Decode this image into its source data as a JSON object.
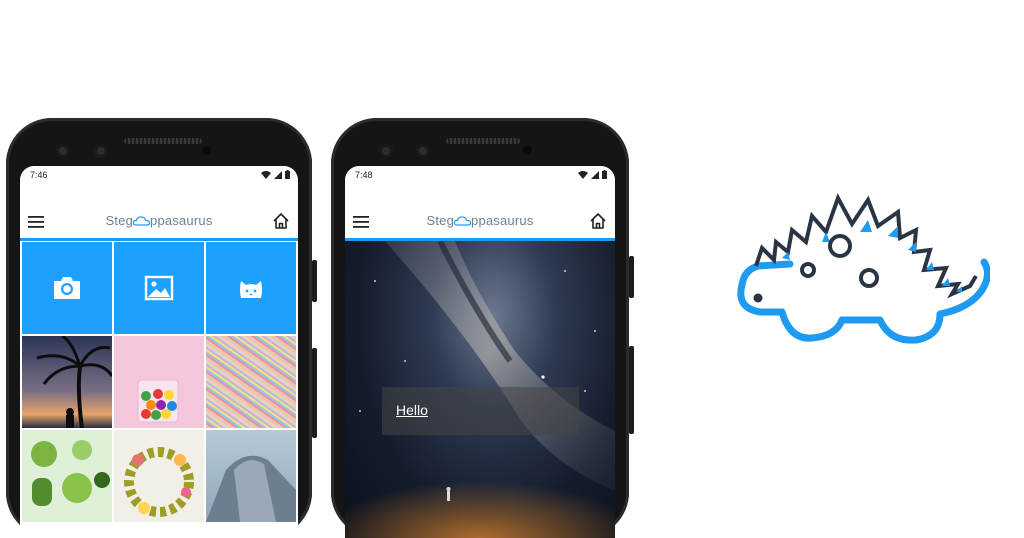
{
  "colors": {
    "accent": "#1e9bf0",
    "tile_blue": "#1ea0ff",
    "dino_dark": "#2a3544"
  },
  "phone1": {
    "status_time": "7:46",
    "brand": {
      "prefix": "Steg",
      "suffix": "ppasaurus"
    },
    "tiles": [
      {
        "icon": "camera-icon"
      },
      {
        "icon": "image-icon"
      },
      {
        "icon": "cat-icon"
      }
    ],
    "thumbnails": [
      {
        "subject": "palm-tree-sunset"
      },
      {
        "subject": "candy-jar"
      },
      {
        "subject": "sprinkles"
      },
      {
        "subject": "vegetables"
      },
      {
        "subject": "floral-wreath"
      },
      {
        "subject": "mountain-rock"
      }
    ]
  },
  "phone2": {
    "status_time": "7:48",
    "brand": {
      "prefix": "Steg",
      "suffix": "ppasaurus"
    },
    "hello_label": "Hello"
  },
  "icons": {
    "menu": "hamburger-menu-icon",
    "home": "home-icon",
    "wifi": "wifi-icon",
    "signal": "cell-signal-icon",
    "battery": "battery-icon"
  }
}
